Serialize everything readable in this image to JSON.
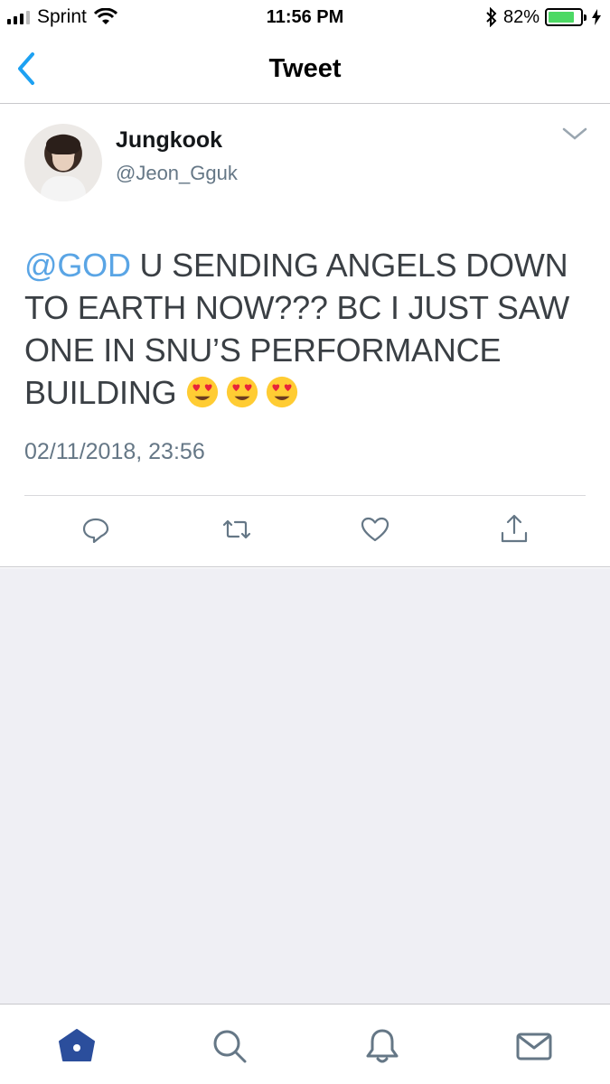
{
  "status_bar": {
    "carrier": "Sprint",
    "time": "11:56 PM",
    "battery_percent": "82%",
    "battery_level": 0.82,
    "icons": [
      "signal-icon",
      "wifi-icon",
      "bluetooth-icon",
      "battery-icon",
      "charging-icon"
    ]
  },
  "nav": {
    "title": "Tweet",
    "back_icon": "chevron-left-icon"
  },
  "tweet": {
    "display_name": "Jungkook",
    "handle": "@Jeon_Gguk",
    "mention": "@GOD",
    "text": " U SENDING ANGELS DOWN TO EARTH NOW??? BC I JUST SAW ONE IN SNU’S PERFORMANCE BUILDING ",
    "emojis": [
      "heart-eyes-emoji",
      "heart-eyes-emoji",
      "heart-eyes-emoji"
    ],
    "timestamp": "02/11/2018, 23:56",
    "actions": [
      "reply-icon",
      "retweet-icon",
      "like-icon",
      "share-icon"
    ]
  },
  "tab_bar": {
    "tabs": [
      "home-icon",
      "search-icon",
      "notifications-icon",
      "messages-icon"
    ],
    "active": "home-icon"
  },
  "colors": {
    "accent": "#1da1f2",
    "mention": "#5aa5e5",
    "tab_active": "#2b4e9c",
    "battery": "#4cd964"
  }
}
